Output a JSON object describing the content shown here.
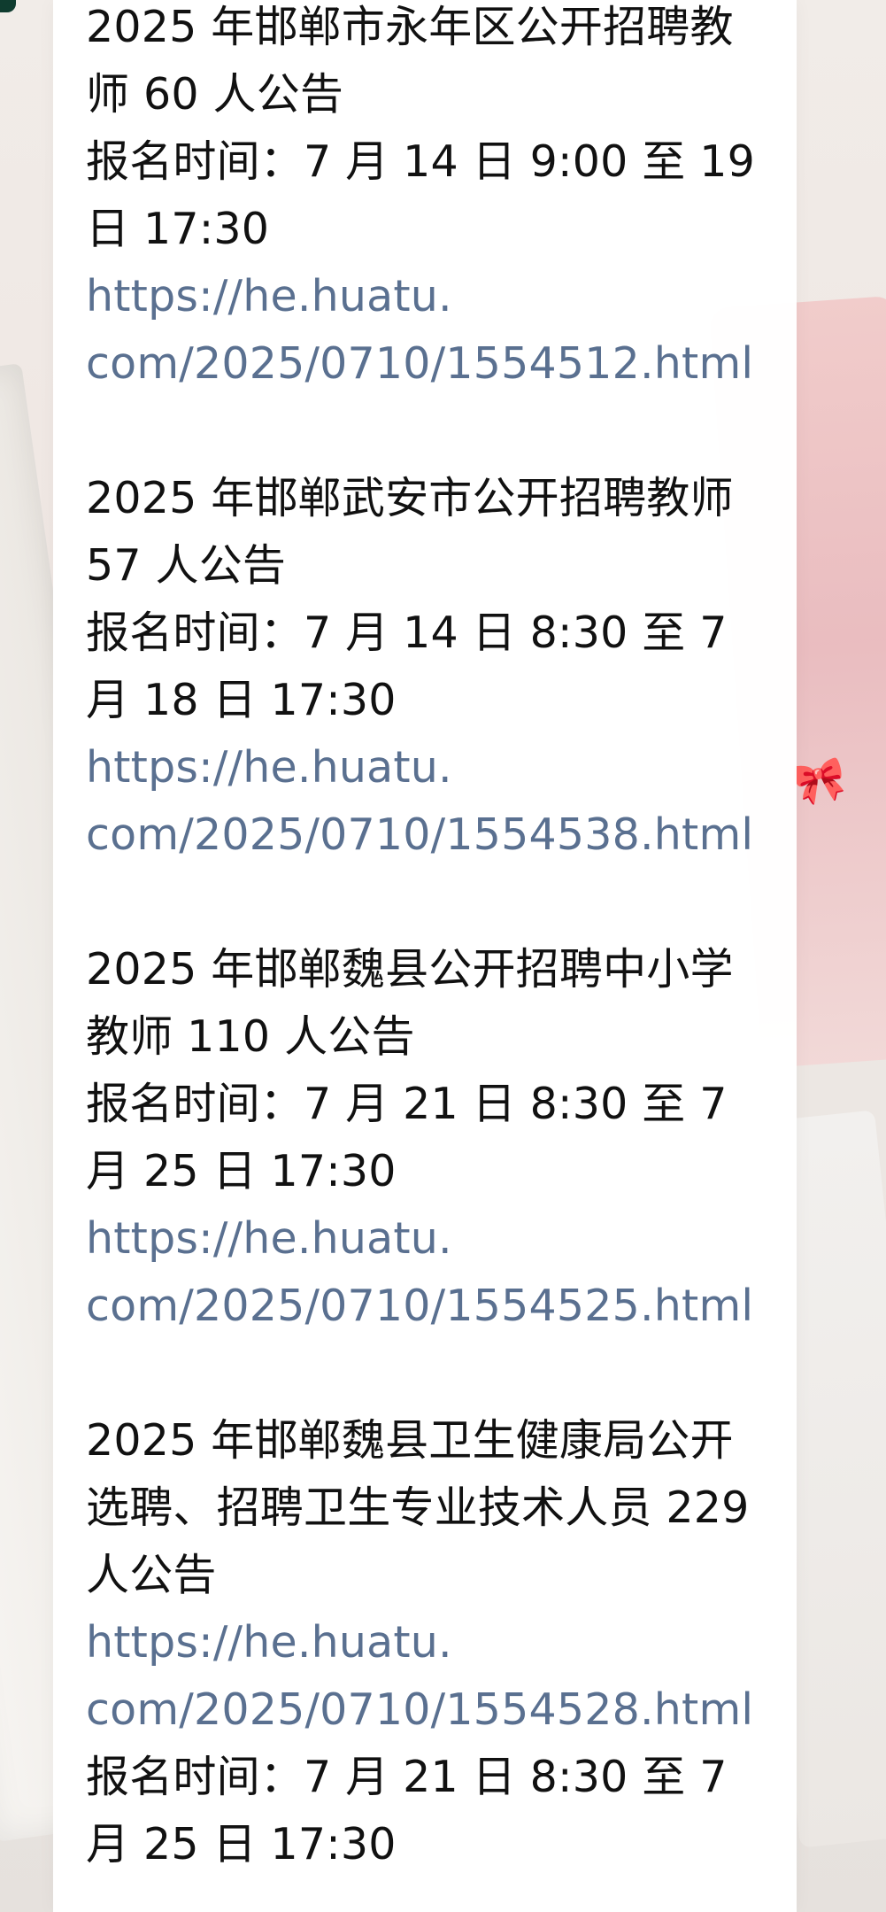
{
  "posts": [
    {
      "title": "2025 年邯郸市永年区公开招聘教师 60 人公告",
      "time": "报名时间：7 月 14 日 9:00 至 19 日 17:30",
      "url_line1": "https://he.huatu.",
      "url_line2": "com/2025/0710/1554512.html"
    },
    {
      "title": "2025 年邯郸武安市公开招聘教师 57 人公告",
      "time": "报名时间：7 月 14 日 8:30 至 7 月 18 日 17:30",
      "url_line1": "https://he.huatu.",
      "url_line2": "com/2025/0710/1554538.html"
    },
    {
      "title": "2025 年邯郸魏县公开招聘中小学教师 110 人公告",
      "time": "报名时间：7 月 21 日 8:30 至 7 月 25 日 17:30",
      "url_line1": "https://he.huatu.",
      "url_line2": "com/2025/0710/1554525.html"
    },
    {
      "title": "2025 年邯郸魏县卫生健康局公开选聘、招聘卫生专业技术人员 229 人公告",
      "url_line1": "https://he.huatu.",
      "url_line2": "com/2025/0710/1554528.html",
      "time": "报名时间：7 月 21 日 8:30 至 7 月 25 日 17:30"
    }
  ],
  "colors": {
    "text": "#111111",
    "link": "#5a7090",
    "card": "#ffffff"
  },
  "icons": {
    "background_bow": "bow-icon"
  }
}
